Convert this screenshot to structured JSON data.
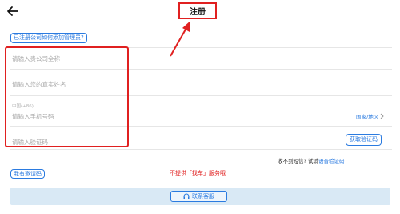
{
  "header": {
    "title": "注册"
  },
  "admin_link": "已注册公司如何添加管理员?",
  "form": {
    "company_placeholder": "请输入贵公司全称",
    "name_placeholder": "请输入您的真实姓名",
    "country_code": "中国(+86)",
    "phone_placeholder": "请输入手机号码",
    "region_link": "国家/地区",
    "code_placeholder": "请输入验证码",
    "get_code_label": "获取验证码"
  },
  "sms": {
    "question": "收不到短信? 试试",
    "voice_link": "语音验证码"
  },
  "invite_button": "我有邀请码",
  "notice": "不提供「找车」服务哦",
  "support_button": "联系客服",
  "colors": {
    "accent": "#2b7be0",
    "highlight": "#e02020",
    "support_bar": "#d9e9f5"
  },
  "icons": {
    "back": "arrow-left-icon",
    "region": "chevron-right-icon",
    "support": "headset-icon"
  }
}
